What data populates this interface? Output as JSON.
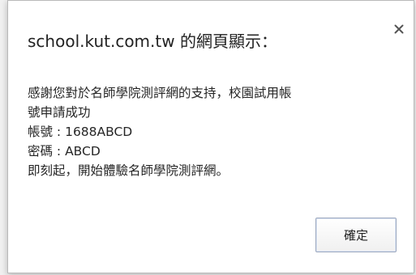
{
  "dialog": {
    "title": "school.kut.com.tw 的網頁顯示：",
    "close_icon": "close-icon",
    "message_lines": [
      "感謝您對於名師學院測評網的支持，校園試用帳",
      "號申請成功",
      "帳號 : 1688ABCD",
      "密碼 : ABCD",
      "即刻起，開始體驗名師學院測評網。"
    ],
    "ok_label": "確定"
  },
  "colors": {
    "background": "#f1f1f1",
    "dialog_bg": "#ffffff",
    "text": "#222222",
    "button_border": "#9ba7bd"
  }
}
